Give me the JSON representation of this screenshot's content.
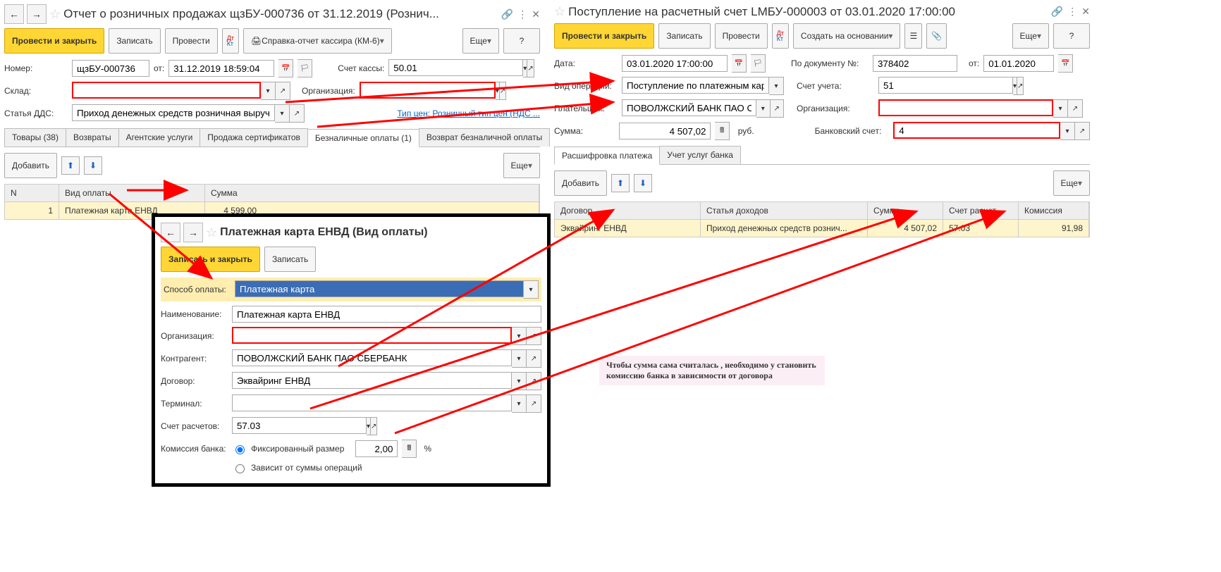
{
  "left": {
    "title": "Отчет о розничных продажах щзБУ-000736 от 31.12.2019 (Рознич...",
    "toolbar": {
      "post_close": "Провести и закрыть",
      "save": "Записать",
      "post": "Провести",
      "print": "Справка-отчет кассира (КМ-6)",
      "more": "Еще",
      "help": "?"
    },
    "fields": {
      "number_lbl": "Номер:",
      "number": "щзБУ-000736",
      "from_lbl": "от:",
      "date": "31.12.2019 18:59:04",
      "cash_lbl": "Счет кассы:",
      "cash": "50.01",
      "warehouse_lbl": "Склад:",
      "org_lbl": "Организация:",
      "dds_lbl": "Статья ДДС:",
      "dds": "Приход денежных средств розничная выручка+",
      "price_link": "Тип цен: Розничный тип цен (НДС ..."
    },
    "tabs": [
      "Товары (38)",
      "Возвраты",
      "Агентские услуги",
      "Продажа сертификатов",
      "Безналичные оплаты (1)",
      "Возврат безналичной оплаты"
    ],
    "active_tab": 4,
    "subbar": {
      "add": "Добавить",
      "more": "Еще"
    },
    "table": {
      "h_n": "N",
      "h_type": "Вид оплаты",
      "h_sum": "Сумма",
      "row": {
        "n": "1",
        "type": "Платежная карта ЕНВД",
        "sum": "4 599,00"
      }
    }
  },
  "popup": {
    "title": "Платежная карта ЕНВД (Вид оплаты)",
    "save_close": "Записать и закрыть",
    "save": "Записать",
    "method_lbl": "Способ оплаты:",
    "method": "Платежная карта",
    "name_lbl": "Наименование:",
    "name": "Платежная карта ЕНВД",
    "org_lbl": "Организация:",
    "ctr_lbl": "Контрагент:",
    "ctr": "ПОВОЛЖСКИЙ БАНК ПАО СБЕРБАНК",
    "contract_lbl": "Договор:",
    "contract": "Эквайринг ЕНВД",
    "terminal_lbl": "Терминал:",
    "terminal": "",
    "acct_lbl": "Счет расчетов:",
    "acct": "57.03",
    "comm_lbl": "Комиссия банка:",
    "r1": "Фиксированный размер",
    "comm": "2,00",
    "pct": "%",
    "r2": "Зависит от суммы операций"
  },
  "right": {
    "title": "Поступление на расчетный счет LMБУ-000003 от 03.01.2020 17:00:00",
    "toolbar": {
      "post_close": "Провести и закрыть",
      "save": "Записать",
      "post": "Провести",
      "create": "Создать на основании",
      "more": "Еще",
      "help": "?"
    },
    "fields": {
      "date_lbl": "Дата:",
      "date": "03.01.2020 17:00:00",
      "doc_lbl": "По документу №:",
      "doc": "378402",
      "from_lbl": "от:",
      "from": "01.01.2020",
      "op_lbl": "Вид операции:",
      "op": "Поступление по платежным картам",
      "acct_lbl": "Счет учета:",
      "acct": "51",
      "payer_lbl": "Плательщик:",
      "payer": "ПОВОЛЖСКИЙ БАНК ПАО СБЕРБАН",
      "org_lbl": "Организация:",
      "sum_lbl": "Сумма:",
      "sum": "4 507,02",
      "cur": "руб.",
      "bank_lbl": "Банковский счет:",
      "bank": "4"
    },
    "tabs": [
      "Расшифровка платежа",
      "Учет услуг банка"
    ],
    "active_tab": 0,
    "subbar": {
      "add": "Добавить",
      "more": "Еще"
    },
    "table": {
      "h1": "Договор",
      "h2": "Статья доходов",
      "h3": "Сумма",
      "h4": "Счет расчет...",
      "h5": "Комиссия",
      "row": {
        "c1": "Эквайринг ЕНВД",
        "c2": "Приход денежных средств рознич...",
        "c3": "4 507,02",
        "c4": "57.03",
        "c5": "91,98"
      }
    }
  },
  "annotation": "Чтобы сумма сама считалась , необходимо у становить комиссию банка в зависимости от договора"
}
